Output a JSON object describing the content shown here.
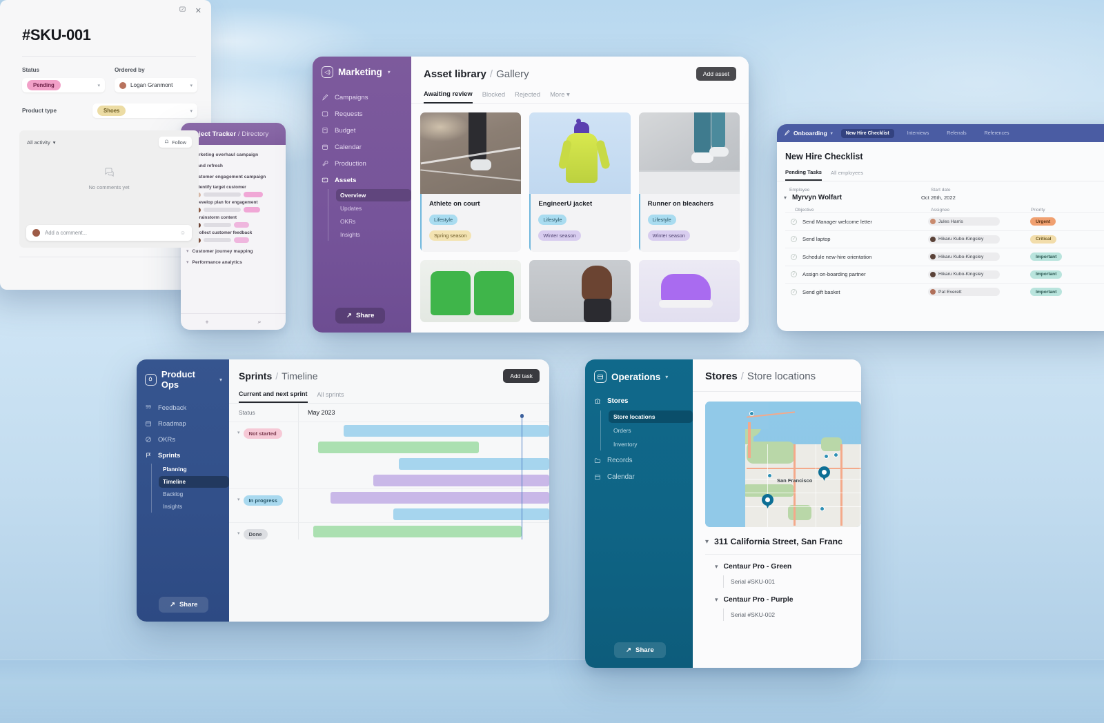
{
  "tracker": {
    "title": "Project Tracker",
    "separator": "/",
    "page": "Directory",
    "groups": [
      {
        "label": "Marketing overhaul campaign"
      },
      {
        "label": "Brand refresh"
      },
      {
        "label": "Customer engagement campaign"
      }
    ],
    "tasks": [
      {
        "name": "Identify target customer"
      },
      {
        "name": "Develop plan for engagement"
      },
      {
        "name": "Brainstorm content"
      },
      {
        "name": "Collect customer feedback"
      }
    ],
    "groups_after": [
      {
        "label": "Customer journey mapping"
      },
      {
        "label": "Performance analytics"
      }
    ],
    "footer": {
      "add": "+",
      "search": "search-icon"
    }
  },
  "marketing": {
    "brand": "Marketing",
    "nav": [
      {
        "label": "Campaigns",
        "icon": "rocket-icon"
      },
      {
        "label": "Requests",
        "icon": "inbox-icon"
      },
      {
        "label": "Budget",
        "icon": "calculator-icon"
      },
      {
        "label": "Calendar",
        "icon": "calendar-icon"
      },
      {
        "label": "Production",
        "icon": "wrench-icon"
      },
      {
        "label": "Assets",
        "icon": "image-icon"
      }
    ],
    "subnav": [
      {
        "label": "Overview"
      },
      {
        "label": "Updates"
      },
      {
        "label": "OKRs"
      },
      {
        "label": "Insights"
      }
    ],
    "share_label": "Share",
    "breadcrumb": {
      "section": "Asset library",
      "sep": "/",
      "page": "Gallery"
    },
    "add_asset_label": "Add asset",
    "tabs": [
      {
        "label": "Awaiting review"
      },
      {
        "label": "Blocked"
      },
      {
        "label": "Rejected"
      },
      {
        "label": "More"
      }
    ],
    "cards": [
      {
        "name": "Athlete  on court",
        "tags": [
          "Lifestyle",
          "Spring season"
        ]
      },
      {
        "name": "EngineerU jacket",
        "tags": [
          "Lifestyle",
          "Winter season"
        ]
      },
      {
        "name": "Runner on bleachers",
        "tags": [
          "Lifestyle",
          "Winter season"
        ]
      }
    ]
  },
  "onboarding": {
    "brand": "Onboarding",
    "tabs": [
      {
        "label": "New Hire Checklist"
      },
      {
        "label": "Interviews"
      },
      {
        "label": "Referrals"
      },
      {
        "label": "References"
      }
    ],
    "title": "New Hire Checklist",
    "subtabs": [
      {
        "label": "Pending Tasks"
      },
      {
        "label": "All employees"
      }
    ],
    "columns": {
      "employee": "Employee",
      "start_date": "Start date",
      "objective": "Objective",
      "assignee": "Assignee",
      "priority": "Priority"
    },
    "employee": {
      "name": "Myrvyn Wolfart",
      "start_date": "Oct 26th, 2022"
    },
    "rows": [
      {
        "objective": "Send Manager welcome letter",
        "assignee": "Jules Harris",
        "avatar_color": "#c98b6e",
        "priority": "Urgent",
        "priority_class": "pri-urgent"
      },
      {
        "objective": "Send laptop",
        "assignee": "Hikaru Kubo-Kingsley",
        "avatar_color": "#5a4238",
        "priority": "Critical",
        "priority_class": "pri-critical"
      },
      {
        "objective": "Schedule new-hire orientation",
        "assignee": "Hikaru Kubo-Kingsley",
        "avatar_color": "#5a4238",
        "priority": "Important",
        "priority_class": "pri-important"
      },
      {
        "objective": "Assign on-boarding partner",
        "assignee": "Hikaru Kubo-Kingsley",
        "avatar_color": "#5a4238",
        "priority": "Important",
        "priority_class": "pri-important"
      },
      {
        "objective": "Send gift basket",
        "assignee": "Pat Everett",
        "avatar_color": "#b0705a",
        "priority": "Important",
        "priority_class": "pri-important"
      }
    ]
  },
  "product_ops": {
    "brand": "Product Ops",
    "nav": [
      {
        "label": "Feedback",
        "icon": "quote-icon"
      },
      {
        "label": "Roadmap",
        "icon": "calendar-icon"
      },
      {
        "label": "OKRs",
        "icon": "target-icon"
      },
      {
        "label": "Sprints",
        "icon": "flag-icon"
      }
    ],
    "subnav": [
      {
        "label": "Planning"
      },
      {
        "label": "Timeline"
      },
      {
        "label": "Backlog"
      },
      {
        "label": "Insights"
      }
    ],
    "share_label": "Share",
    "breadcrumb": {
      "section": "Sprints",
      "sep": "/",
      "page": "Timeline"
    },
    "add_task_label": "Add task",
    "tabs": [
      {
        "label": "Current and next sprint"
      },
      {
        "label": "All sprints"
      }
    ],
    "status_col": "Status",
    "month": "May",
    "year": "2023",
    "chart_data": {
      "type": "bar",
      "title": "Sprints Timeline — May 2023",
      "xlabel": "May 2023",
      "ylabel": "Status",
      "groups": [
        {
          "status": "Not started",
          "bars": [
            {
              "start_pct": 18,
              "width_pct": 82,
              "color": "#a6d5ee"
            },
            {
              "start_pct": 8,
              "width_pct": 64,
              "color": "#abe0b1"
            },
            {
              "start_pct": 40,
              "width_pct": 60,
              "color": "#a6d5ee"
            },
            {
              "start_pct": 30,
              "width_pct": 70,
              "color": "#c9b8e8"
            }
          ]
        },
        {
          "status": "In progress",
          "bars": [
            {
              "start_pct": 13,
              "width_pct": 87,
              "color": "#c9b8e8"
            },
            {
              "start_pct": 38,
              "width_pct": 62,
              "color": "#a6d5ee"
            }
          ]
        },
        {
          "status": "Done",
          "bars": [
            {
              "start_pct": 6,
              "width_pct": 83,
              "color": "#abe0b1"
            }
          ]
        }
      ],
      "today_marker_pct": 57
    }
  },
  "operations": {
    "brand": "Operations",
    "nav": [
      {
        "label": "Stores",
        "icon": "bank-icon"
      },
      {
        "label": "Records",
        "icon": "folder-icon"
      },
      {
        "label": "Calendar",
        "icon": "calendar-icon"
      }
    ],
    "subnav": [
      {
        "label": "Store locations"
      },
      {
        "label": "Orders"
      },
      {
        "label": "Inventory"
      }
    ],
    "share_label": "Share",
    "breadcrumb": {
      "section": "Stores",
      "sep": "/",
      "page": "Store locations"
    },
    "map": {
      "city_label": "San Francisco"
    },
    "location": "311 California Street, San Franc",
    "products": [
      {
        "name": "Centaur Pro - Green",
        "serial": "Serial #SKU-001"
      },
      {
        "name": "Centaur Pro - Purple",
        "serial": "Serial #SKU-002"
      }
    ]
  },
  "sku_modal": {
    "title": "#SKU-001",
    "expand_icon": "expand-icon",
    "close_icon": "close-icon",
    "status_label": "Status",
    "status_value": "Pending",
    "ordered_by_label": "Ordered by",
    "ordered_by_value": "Logan Granmont",
    "product_type_label": "Product type",
    "product_type_value": "Shoes",
    "activity_filter": "All activity",
    "follow_label": "Follow",
    "empty_text": "No comments yet",
    "comment_placeholder": "Add a comment..."
  },
  "colors": {
    "marketing_purple": "#7d5a9c",
    "onboarding_blue": "#4a5ca3",
    "productops_navy": "#36558f",
    "operations_teal": "#10698b",
    "tracker_purple": "#8a6aa8"
  }
}
